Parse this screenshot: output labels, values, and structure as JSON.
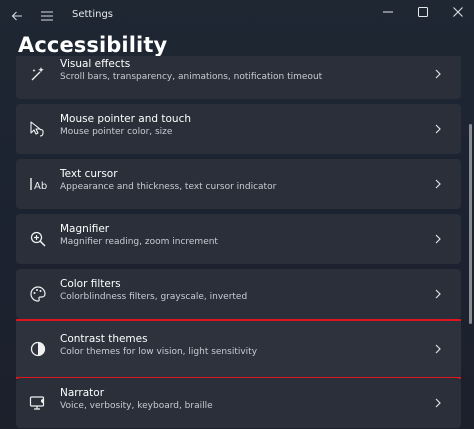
{
  "titlebar": {
    "title": "Settings"
  },
  "page": {
    "title": "Accessibility"
  },
  "items": [
    {
      "title": "Visual effects",
      "subtitle": "Scroll bars, transparency, animations, notification timeout",
      "icon": "visual-effects-icon"
    },
    {
      "title": "Mouse pointer and touch",
      "subtitle": "Mouse pointer color, size",
      "icon": "mouse-pointer-icon"
    },
    {
      "title": "Text cursor",
      "subtitle": "Appearance and thickness, text cursor indicator",
      "icon": "text-cursor-icon"
    },
    {
      "title": "Magnifier",
      "subtitle": "Magnifier reading, zoom increment",
      "icon": "magnifier-icon"
    },
    {
      "title": "Color filters",
      "subtitle": "Colorblindness filters, grayscale, inverted",
      "icon": "color-filters-icon"
    },
    {
      "title": "Contrast themes",
      "subtitle": "Color themes for low vision, light sensitivity",
      "icon": "contrast-icon",
      "highlighted": true
    },
    {
      "title": "Narrator",
      "subtitle": "Voice, verbosity, keyboard, braille",
      "icon": "narrator-icon"
    }
  ],
  "colors": {
    "highlight_border": "#e0141e",
    "card_bg": "#2a2f3a"
  }
}
